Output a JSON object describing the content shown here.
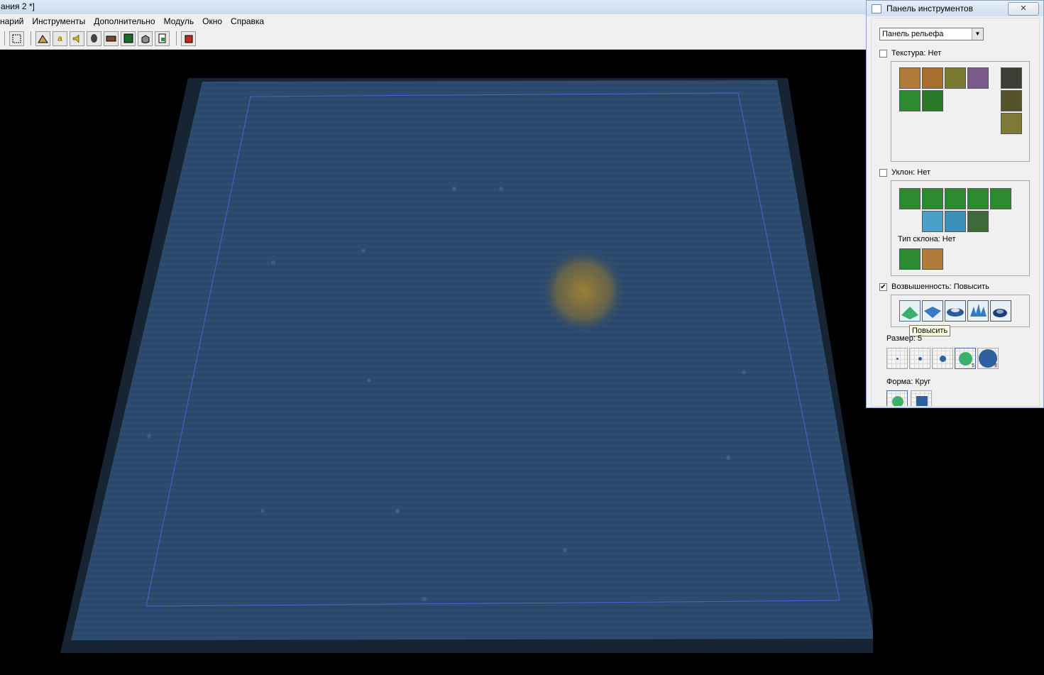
{
  "window": {
    "title": "ания 2 *]"
  },
  "menu": [
    "нарий",
    "Инструменты",
    "Дополнительно",
    "Модуль",
    "Окно",
    "Справка"
  ],
  "panel": {
    "title": "Панель инструментов",
    "close_icon": "close-icon",
    "dropdown_value": "Панель рельефа",
    "texture": {
      "label": "Текстура: Нет",
      "checked": false
    },
    "slope": {
      "label": "Уклон: Нет",
      "checked": false,
      "type_label": "Тип склона: Нет"
    },
    "elevation": {
      "label": "Возвышенность: Повысить",
      "checked": true,
      "tooltip": "Повысить"
    },
    "size": {
      "label": "Размер: 5",
      "values": [
        "1",
        "2",
        "3",
        "5",
        "8"
      ]
    },
    "shape": {
      "label": "Форма: Круг"
    }
  },
  "colors": {
    "terrain": "#2c4a6e",
    "boundary": "#4a63d8",
    "brush": "#b08a2a",
    "panel_bg": "#f0f0f0"
  }
}
